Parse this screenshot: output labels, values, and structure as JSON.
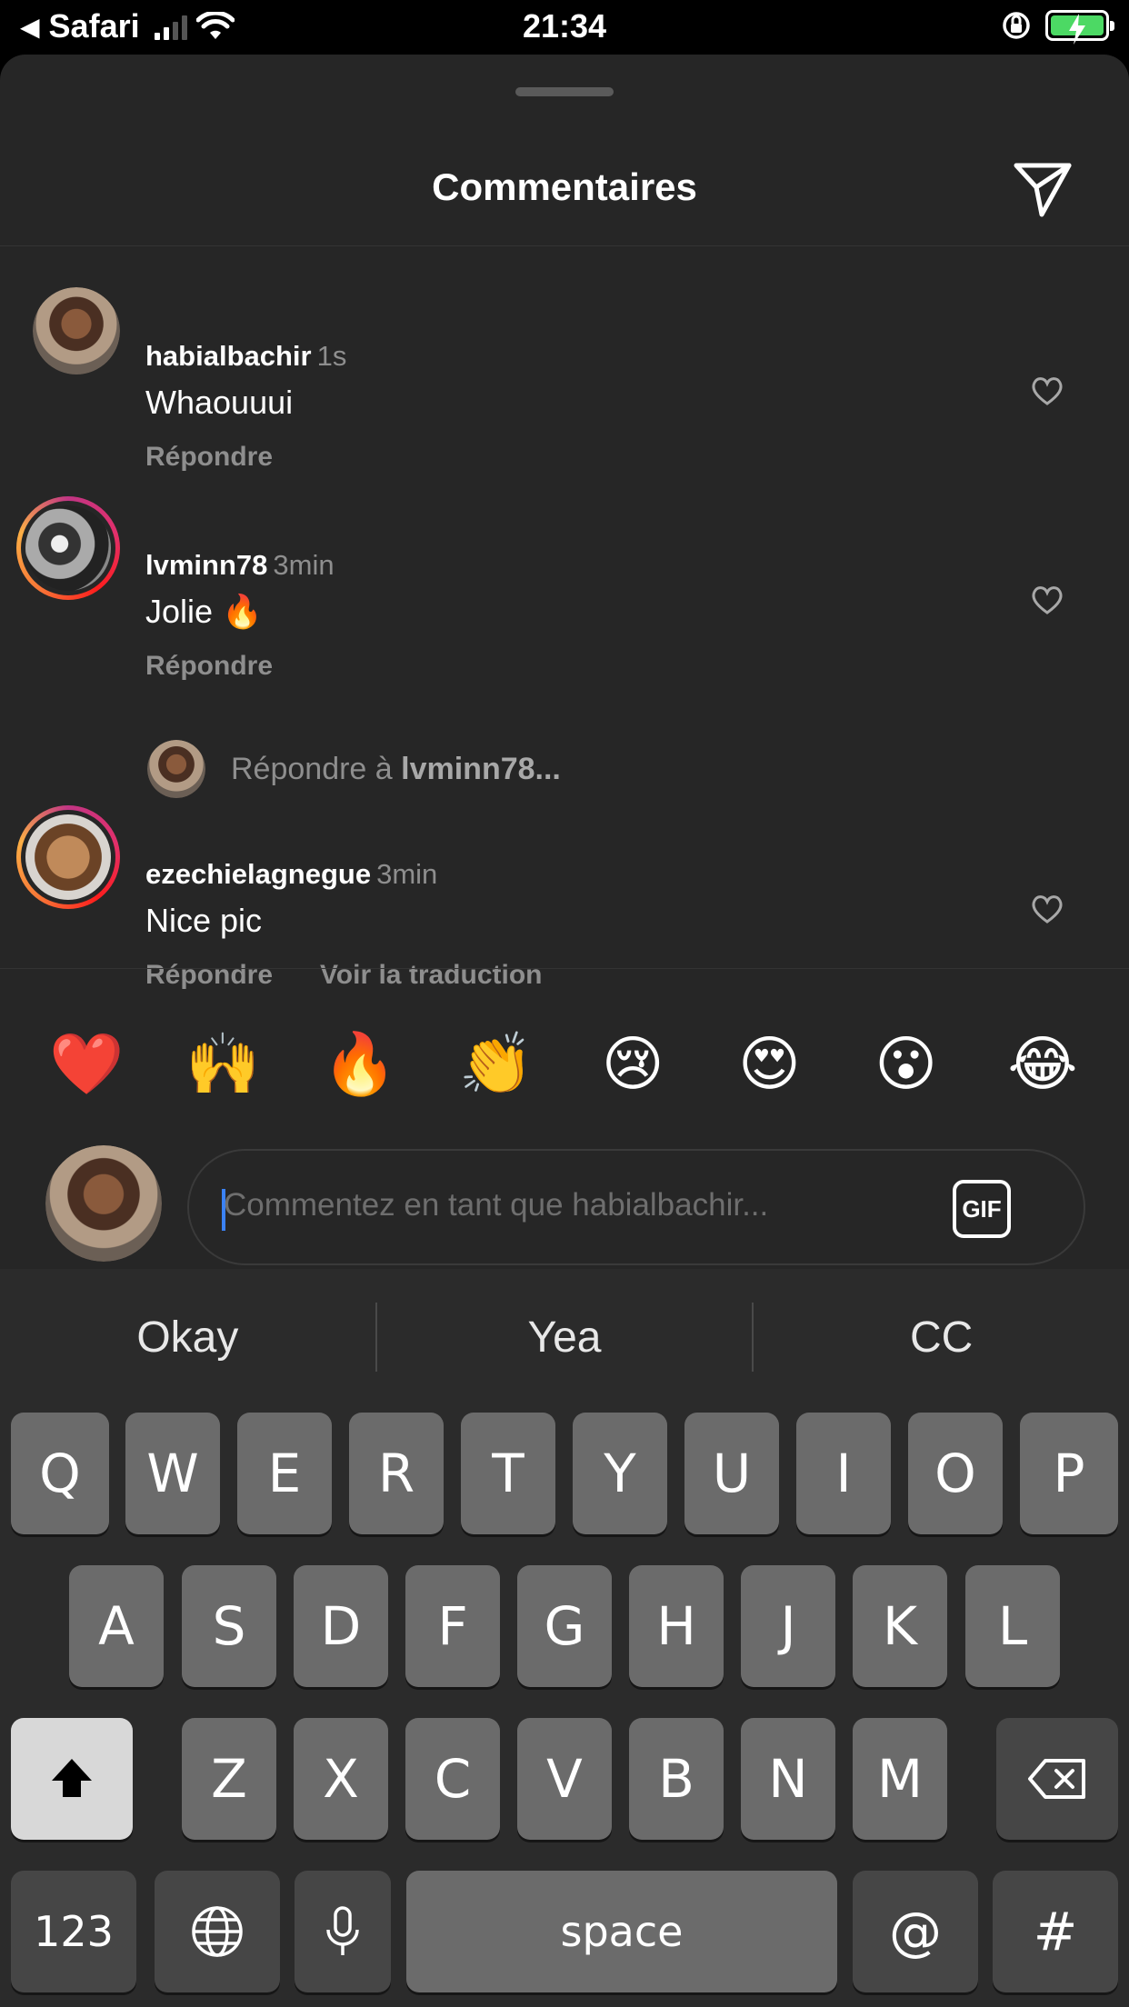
{
  "status_bar": {
    "back_app": "Safari",
    "time": "21:34"
  },
  "sheet": {
    "title": "Commentaires"
  },
  "comments": [
    {
      "username": "habialbachir",
      "time": "1s",
      "text": "Whaouuui",
      "reply": "Répondre"
    },
    {
      "username": "lvminn78",
      "time": "3min",
      "text": "Jolie 🔥",
      "reply": "Répondre"
    },
    {
      "username": "ezechielagnegue",
      "time": "3min",
      "text": "Nice pic",
      "reply": "Répondre",
      "translate": "Voir la traduction"
    }
  ],
  "reply_prompt": {
    "prefix": "Répondre à ",
    "user": "lvminn78",
    "suffix": "..."
  },
  "emojis": [
    "❤️",
    "🙌",
    "🔥",
    "👏",
    "😢",
    "😍",
    "😮",
    "😂"
  ],
  "composer": {
    "placeholder": "Commentez en tant que habialbachir...",
    "gif_label": "GIF"
  },
  "keyboard": {
    "suggestions": [
      "Okay",
      "Yea",
      "CC"
    ],
    "row1": [
      "Q",
      "W",
      "E",
      "R",
      "T",
      "Y",
      "U",
      "I",
      "O",
      "P"
    ],
    "row2": [
      "A",
      "S",
      "D",
      "F",
      "G",
      "H",
      "J",
      "K",
      "L"
    ],
    "row3": [
      "Z",
      "X",
      "C",
      "V",
      "B",
      "N",
      "M"
    ],
    "numbers_label": "123",
    "space_label": "space",
    "at_label": "@",
    "hash_label": "#"
  }
}
